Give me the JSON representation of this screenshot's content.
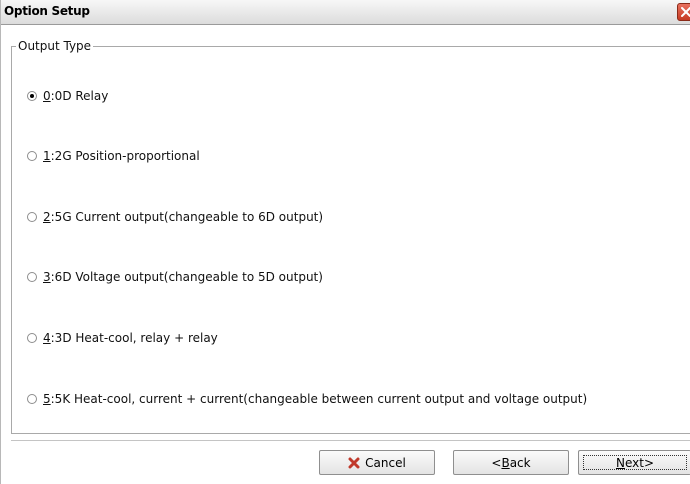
{
  "window": {
    "title": "Option Setup"
  },
  "group": {
    "legend": "Output Type"
  },
  "options": [
    {
      "key": "0",
      "rest": ":0D Relay",
      "checked": true
    },
    {
      "key": "1",
      "rest": ":2G Position-proportional",
      "checked": false
    },
    {
      "key": "2",
      "rest": ":5G Current output(changeable to 6D output)",
      "checked": false
    },
    {
      "key": "3",
      "rest": ":6D Voltage output(changeable to 5D output)",
      "checked": false
    },
    {
      "key": "4",
      "rest": ":3D Heat-cool, relay + relay",
      "checked": false
    },
    {
      "key": "5",
      "rest": ":5K Heat-cool, current + current(changeable between current output and voltage output)",
      "checked": false
    }
  ],
  "buttons": {
    "cancel": {
      "icon": "cancel-x-icon",
      "label": "Cancel"
    },
    "back": {
      "prefix": "<",
      "key": "B",
      "rest": "ack"
    },
    "next": {
      "key": "N",
      "rest": "ext>"
    }
  },
  "colors": {
    "cancel_icon": "#c0392b",
    "close_button": "#d04a30"
  }
}
